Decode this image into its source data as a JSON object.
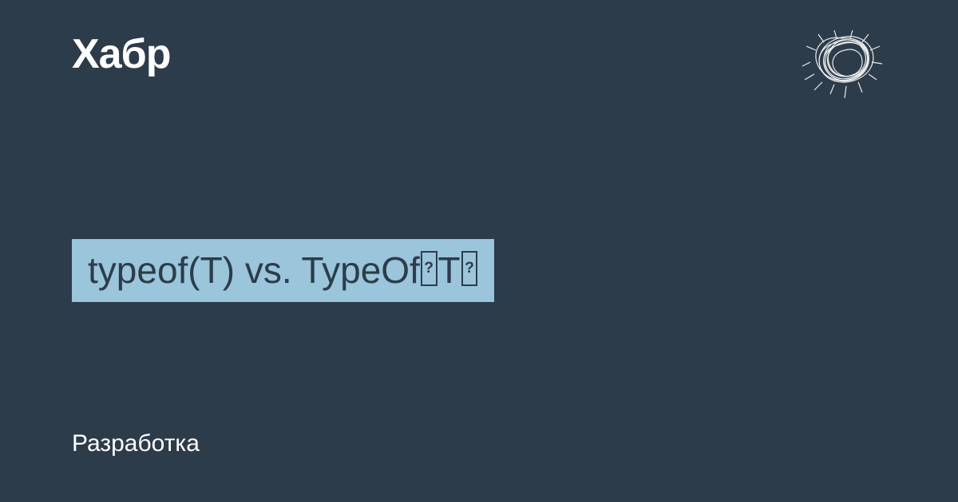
{
  "header": {
    "logo_text": "Хабр"
  },
  "article": {
    "title_part1": "typeof(T) vs. TypeOf",
    "title_part2": "T",
    "category": "Разработка"
  },
  "colors": {
    "background": "#2d3c4a",
    "highlight": "#9ac5db",
    "text_light": "#ffffff"
  }
}
